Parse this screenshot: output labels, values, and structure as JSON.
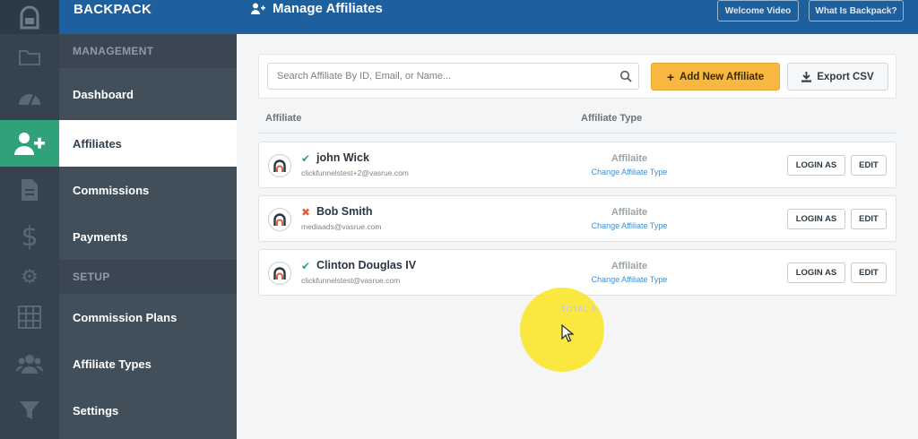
{
  "app": {
    "brand": "BACKPACK",
    "page_title": "Manage Affiliates"
  },
  "topbar": {
    "welcome_video": "Welcome Video",
    "what_is": "What Is Backpack?"
  },
  "sidebar": {
    "management_label": "MANAGEMENT",
    "setup_label": "SETUP",
    "items": [
      {
        "label": "Dashboard",
        "icon": "dashboard-gauge-icon"
      },
      {
        "label": "Affiliates",
        "icon": "add-user-icon",
        "active": true
      },
      {
        "label": "Commissions",
        "icon": "document-icon"
      },
      {
        "label": "Payments",
        "icon": "dollar-icon"
      },
      {
        "label": "Commission Plans",
        "icon": "calculator-icon"
      },
      {
        "label": "Affiliate Types",
        "icon": "users-group-icon"
      },
      {
        "label": "Settings",
        "icon": "filter-icon"
      }
    ]
  },
  "toolbar": {
    "search_placeholder": "Search Affiliate By ID, Email, or Name...",
    "add_label": "Add New Affiliate",
    "export_label": "Export CSV"
  },
  "table": {
    "col_affiliate": "Affiliate",
    "col_type": "Affiliate Type",
    "rows": [
      {
        "status": "✔",
        "name": "john Wick",
        "email": "clickfunnelstest+2@vasrue.com",
        "type": "Affilaite",
        "change": "Change Affiliate Type",
        "login": "LOGIN AS",
        "edit": "EDIT"
      },
      {
        "status": "✖",
        "name": "Bob Smith",
        "email": "mediaads@vasrue.com",
        "type": "Affilaite",
        "change": "Change Affiliate Type",
        "login": "LOGIN AS",
        "edit": "EDIT"
      },
      {
        "status": "✔",
        "name": "Clinton Douglas IV",
        "email": "clickfunnelstest@vasrue.com",
        "type": "Affilaite",
        "change": "Change Affiliate Type",
        "login": "LOGIN AS",
        "edit": "EDIT"
      }
    ],
    "total_label": "TOTAL 3"
  },
  "colors": {
    "topbar": "#1e5f9e",
    "sidebar": "#414f5a",
    "active": "#2fa27a",
    "add_button": "#f8b740"
  }
}
